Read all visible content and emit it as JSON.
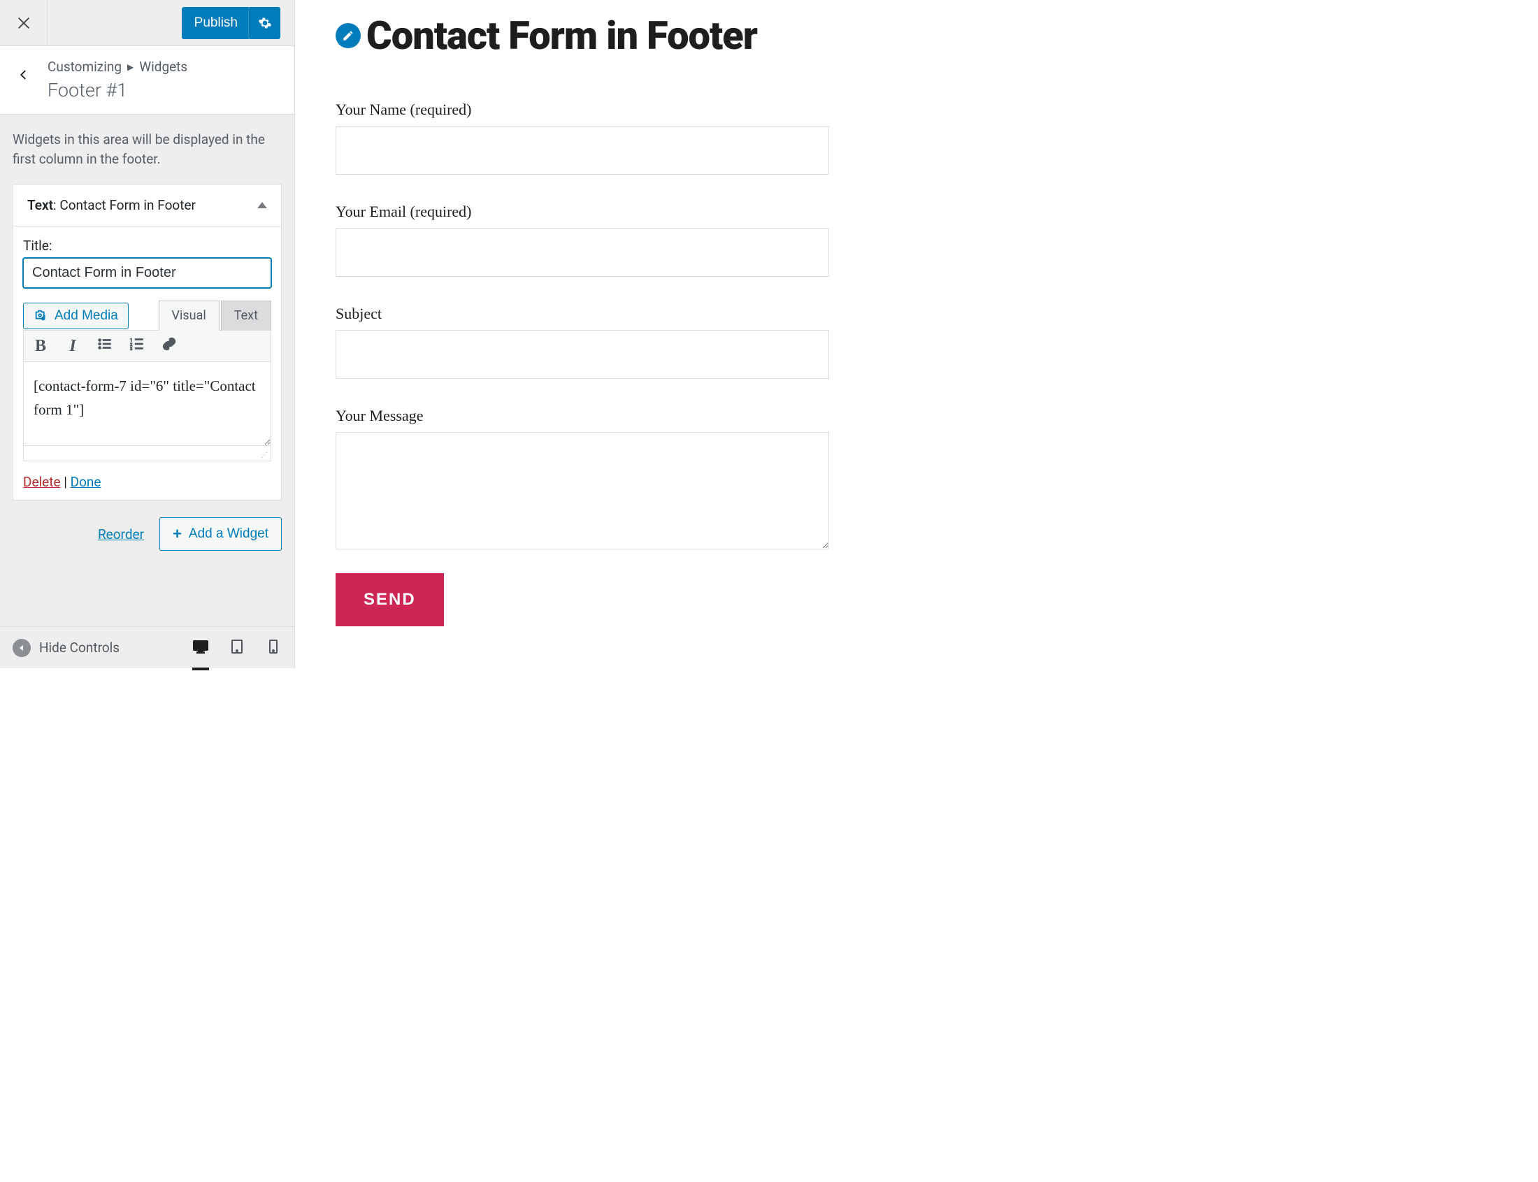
{
  "topbar": {
    "publish_label": "Publish"
  },
  "breadcrumbs": {
    "root": "Customizing",
    "parent": "Widgets",
    "section": "Footer #1"
  },
  "sidebar_description": "Widgets in this area will be displayed in the first column in the footer.",
  "widget": {
    "header_prefix": "Text",
    "header_title": "Contact Form in Footer",
    "title_label": "Title:",
    "title_value": "Contact Form in Footer",
    "add_media_label": "Add Media",
    "tab_visual": "Visual",
    "tab_text": "Text",
    "editor_content": "[contact-form-7 id=\"6\" title=\"Contact form 1\"]",
    "delete_label": "Delete",
    "done_label": "Done"
  },
  "bottom": {
    "reorder_label": "Reorder",
    "add_widget_label": "Add a Widget"
  },
  "footer": {
    "hide_controls": "Hide Controls"
  },
  "preview": {
    "heading": "Contact Form in Footer",
    "form": {
      "name_label": "Your Name (required)",
      "email_label": "Your Email (required)",
      "subject_label": "Subject",
      "message_label": "Your Message",
      "send_label": "SEND"
    }
  }
}
